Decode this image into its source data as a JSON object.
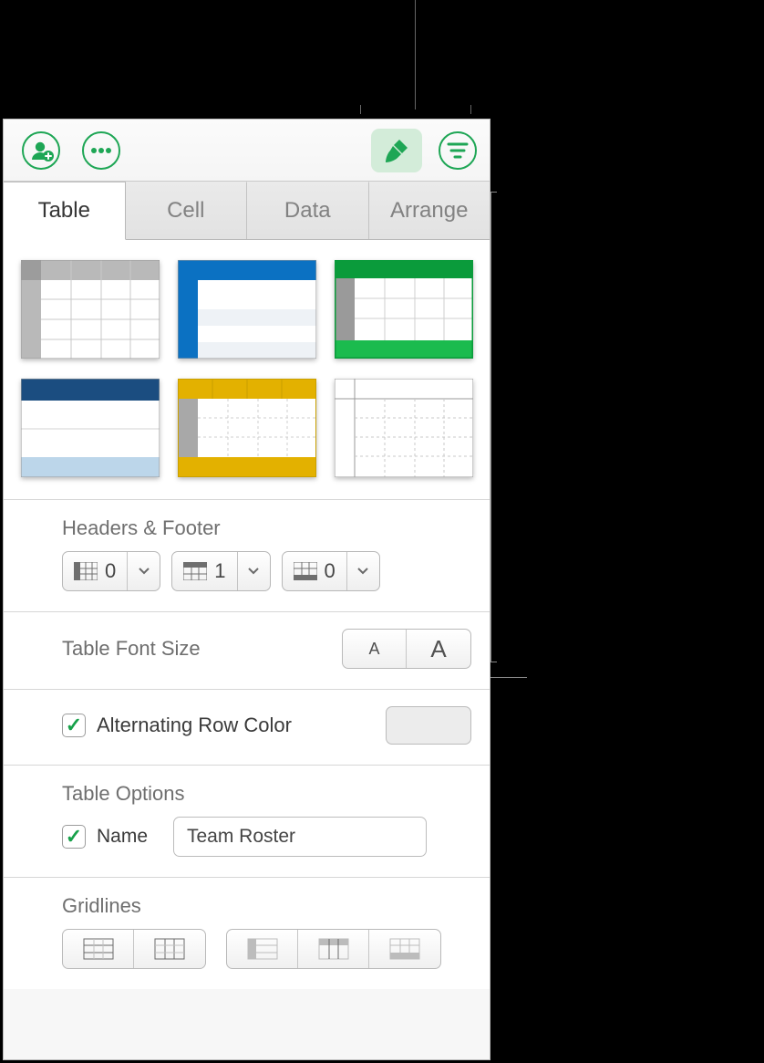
{
  "toolbar": {
    "collaborate_icon": "collaborate-icon",
    "more_icon": "more-icon",
    "format_icon": "format-brush-icon",
    "filter_icon": "filter-icon"
  },
  "tabs": {
    "table": "Table",
    "cell": "Cell",
    "data": "Data",
    "arrange": "Arrange",
    "active": "table"
  },
  "headers_footer": {
    "title": "Headers & Footer",
    "header_cols": "0",
    "header_rows": "1",
    "footer_rows": "0"
  },
  "font_size": {
    "title": "Table Font Size",
    "small": "A",
    "large": "A"
  },
  "alt_row": {
    "label": "Alternating Row Color",
    "checked": true,
    "color": "#ececec"
  },
  "options": {
    "title": "Table Options",
    "name_label": "Name",
    "name_checked": true,
    "name_value": "Team Roster"
  },
  "gridlines": {
    "title": "Gridlines"
  }
}
